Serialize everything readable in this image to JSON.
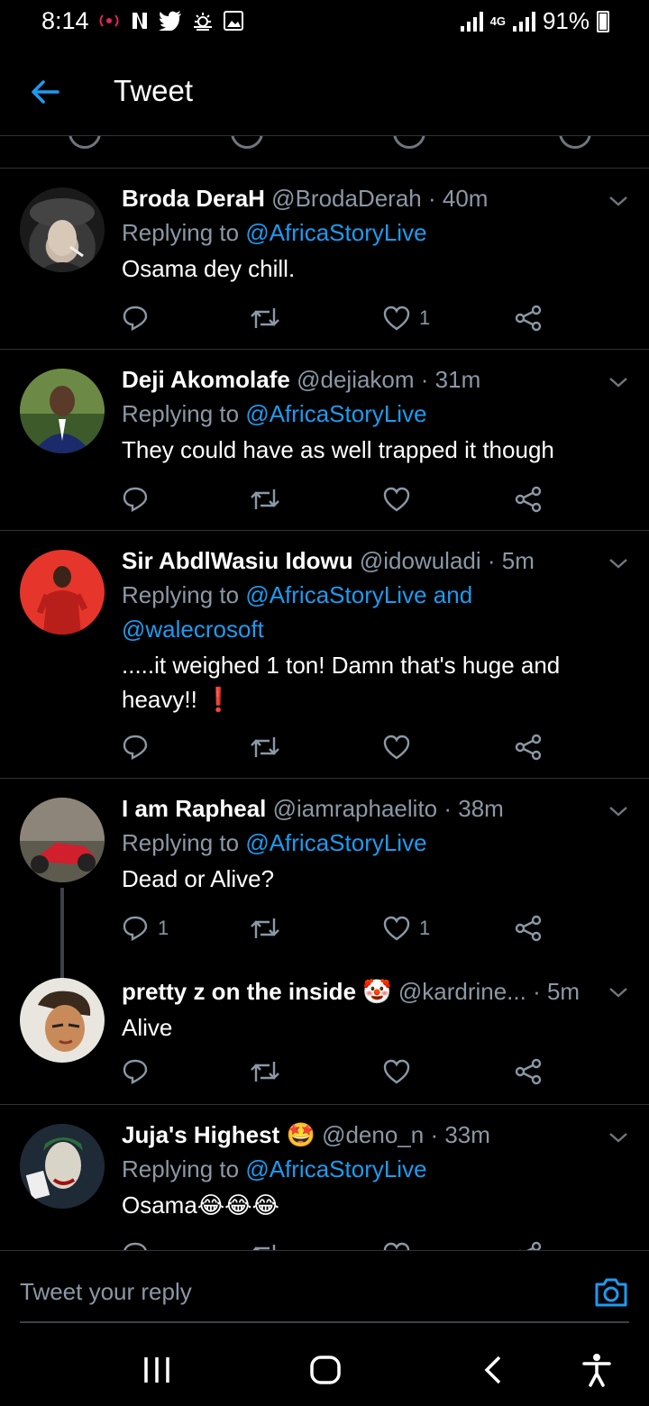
{
  "status_bar": {
    "time": "8:14",
    "network": "4G",
    "battery": "91%"
  },
  "header": {
    "title": "Tweet"
  },
  "tweets": [
    {
      "name": "Broda DeraH",
      "handle": "@BrodaDerah",
      "time": "40m",
      "replying_label": "Replying to",
      "mentions": "@AfricaStoryLive",
      "text": "Osama dey chill.",
      "replies": "",
      "likes": "1"
    },
    {
      "name": "Deji Akomolafe",
      "handle": "@dejiakom",
      "time": "31m",
      "replying_label": "Replying to",
      "mentions": "@AfricaStoryLive",
      "text": "They could have as well trapped it though",
      "replies": "",
      "likes": ""
    },
    {
      "name": "Sir AbdlWasiu Idowu",
      "handle": "@idowuladi",
      "time": "5m",
      "replying_label": "Replying to",
      "mentions": "@AfricaStoryLive and",
      "mentions2": "@walecrosoft",
      "text": ".....it weighed 1 ton! Damn that's huge and heavy!! ❗",
      "replies": "",
      "likes": ""
    },
    {
      "name": "I am Rapheal",
      "handle": "@iamraphaelito",
      "time": "38m",
      "replying_label": "Replying to",
      "mentions": "@AfricaStoryLive",
      "text": "Dead or Alive?",
      "replies": "1",
      "likes": "1"
    },
    {
      "name": "pretty z on the inside 🤡",
      "handle": "@kardrine...",
      "time": "5m",
      "text": "Alive",
      "replies": "",
      "likes": ""
    },
    {
      "name": "Juja's Highest 🤩",
      "handle": "@deno_n",
      "time": "33m",
      "replying_label": "Replying to",
      "mentions": "@AfricaStoryLive",
      "text": "Osama😂😂😂",
      "replies": "",
      "likes": ""
    }
  ],
  "reply_bar": {
    "placeholder": "Tweet your reply"
  },
  "colors": {
    "accent": "#1d9bf0",
    "muted": "#8b98a5",
    "divider": "#2f3336",
    "background": "#000000"
  },
  "icons": [
    "back-arrow-icon",
    "chevron-down-icon",
    "reply-icon",
    "retweet-icon",
    "like-icon",
    "share-icon",
    "camera-icon",
    "recents-icon",
    "home-icon",
    "back-icon",
    "accessibility-icon"
  ]
}
